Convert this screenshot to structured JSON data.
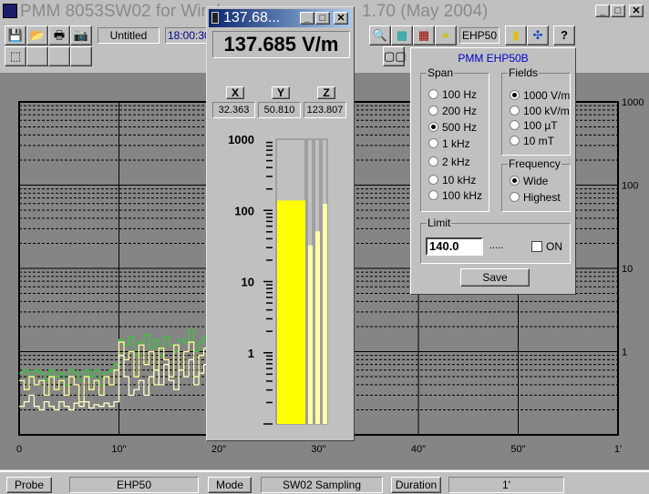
{
  "window": {
    "title": "PMM 8053SW02 for Windows 1.70 (May 2004)",
    "title_left": "PMM 8053SW02 for Wind",
    "title_right": "1.70 (May 2004)"
  },
  "toolbar": {
    "file_name": "Untitled",
    "time": "18:00:30",
    "probe_label": "EHP50",
    "icons": [
      "save-icon",
      "open-icon",
      "print-icon",
      "camera-icon",
      "probe-icon",
      "zoom-icon",
      "grid-icon",
      "grid-print-icon",
      "spectrum-icon",
      "bar-icon",
      "color-icon",
      "help-icon",
      "dual-icon"
    ]
  },
  "probe_window": {
    "title": "137.68...",
    "reading": "137.685 V/m",
    "axes": [
      {
        "label": "X",
        "value": "32.363",
        "level": 32.363
      },
      {
        "label": "Y",
        "value": "50.810",
        "level": 50.81
      },
      {
        "label": "Z",
        "value": "123.807",
        "level": 123.807
      }
    ],
    "total_level": 137.685,
    "scale_labels": [
      "1000",
      "100",
      "10",
      "1"
    ],
    "bar_color": "#ffff00",
    "axis_bar_color": "#ffffa8"
  },
  "settings_panel": {
    "title": "PMM EHP50B",
    "span": {
      "label": "Span",
      "options": [
        "100 Hz",
        "200 Hz",
        "500 Hz",
        "1 kHz",
        "2 kHz",
        "10 kHz",
        "100 kHz"
      ],
      "selected": "500 Hz"
    },
    "fields": {
      "label": "Fields",
      "options": [
        "1000 V/m",
        "100 kV/m",
        "100 µT",
        "10 mT"
      ],
      "selected": "1000 V/m"
    },
    "frequency": {
      "label": "Frequency",
      "options": [
        "Wide",
        "Highest"
      ],
      "selected": "Wide"
    },
    "limit": {
      "label": "Limit",
      "value": "140.0",
      "dashes": ".....",
      "on_label": "ON",
      "on_checked": false
    },
    "save_label": "Save"
  },
  "chart_data": {
    "type": "line",
    "y_scale": "log",
    "ylim": [
      0.1,
      1000
    ],
    "xlim": [
      0,
      60
    ],
    "x_tick_labels": [
      "0",
      "10\"",
      "20\"",
      "30\"",
      "40\"",
      "50\"",
      "1'"
    ],
    "y_tick_labels": [
      "1000",
      "100",
      "10",
      "1"
    ],
    "grid": true,
    "series": [
      {
        "color": "#33cc33",
        "x": [
          0,
          0.5,
          1,
          1.5,
          2,
          2.5,
          3,
          3.5,
          4,
          4.5,
          5,
          5.5,
          6,
          6.5,
          7,
          7.5,
          8,
          8.5,
          9,
          9.5,
          10,
          10.5,
          11,
          11.5,
          12,
          12.5,
          13,
          13.5,
          14,
          14.5,
          15,
          15.5,
          16,
          16.5,
          17,
          17.5,
          18,
          18.5,
          19,
          19.5,
          20
        ],
        "y": [
          0.55,
          0.6,
          0.5,
          0.6,
          0.55,
          0.45,
          0.6,
          0.5,
          0.55,
          0.4,
          0.6,
          0.55,
          0.45,
          0.6,
          0.5,
          0.6,
          0.4,
          0.55,
          0.6,
          0.7,
          1.4,
          1.2,
          1.5,
          0.9,
          1.3,
          1.6,
          1.1,
          1.4,
          0.9,
          1.5,
          1.2,
          1.0,
          1.4,
          1.3,
          1.8,
          1.0,
          1.3,
          1.5,
          1.1,
          1.4,
          1.2
        ]
      },
      {
        "color": "#ffff99",
        "x": [
          0,
          0.5,
          1,
          1.5,
          2,
          2.5,
          3,
          3.5,
          4,
          4.5,
          5,
          5.5,
          6,
          6.5,
          7,
          7.5,
          8,
          8.5,
          9,
          9.5,
          10,
          10.5,
          11,
          11.5,
          12,
          12.5,
          13,
          13.5,
          14,
          14.5,
          15,
          15.5,
          16,
          16.5,
          17,
          17.5,
          18,
          18.5,
          19,
          19.5,
          20
        ],
        "y": [
          0.45,
          0.35,
          0.5,
          0.4,
          0.45,
          0.3,
          0.5,
          0.35,
          0.45,
          0.3,
          0.5,
          0.4,
          0.25,
          0.5,
          0.35,
          0.45,
          0.3,
          0.5,
          0.4,
          0.6,
          1.3,
          0.8,
          1.0,
          0.5,
          1.2,
          0.7,
          1.0,
          0.4,
          1.1,
          0.8,
          0.5,
          1.2,
          0.6,
          1.0,
          1.3,
          0.5,
          0.9,
          1.1,
          0.6,
          1.0,
          0.7
        ]
      },
      {
        "color": "#ffffcc",
        "x": [
          0,
          0.5,
          1,
          1.5,
          2,
          2.5,
          3,
          3.5,
          4,
          4.5,
          5,
          5.5,
          6,
          6.5,
          7,
          7.5,
          8,
          8.5,
          9,
          9.5,
          10,
          10.5,
          11,
          11.5,
          12,
          12.5,
          13,
          13.5,
          14,
          14.5,
          15,
          15.5,
          16,
          16.5,
          17,
          17.5,
          18,
          18.5,
          19,
          19.5,
          20
        ],
        "y": [
          0.22,
          0.25,
          0.3,
          0.22,
          0.2,
          0.25,
          0.22,
          0.2,
          0.25,
          0.22,
          0.2,
          0.24,
          0.22,
          0.25,
          0.21,
          0.23,
          0.22,
          0.24,
          0.22,
          0.25,
          0.9,
          0.5,
          0.3,
          0.35,
          0.45,
          0.3,
          0.5,
          0.6,
          0.4,
          0.7,
          0.45,
          0.35,
          0.6,
          0.5,
          0.8,
          0.4,
          0.55,
          0.7,
          0.45,
          0.6,
          0.5
        ]
      }
    ]
  },
  "status": {
    "probe_label": "Probe",
    "probe_value": "EHP50",
    "mode_label": "Mode",
    "mode_value": "SW02 Sampling",
    "duration_label": "Duration",
    "duration_value": "1'"
  }
}
